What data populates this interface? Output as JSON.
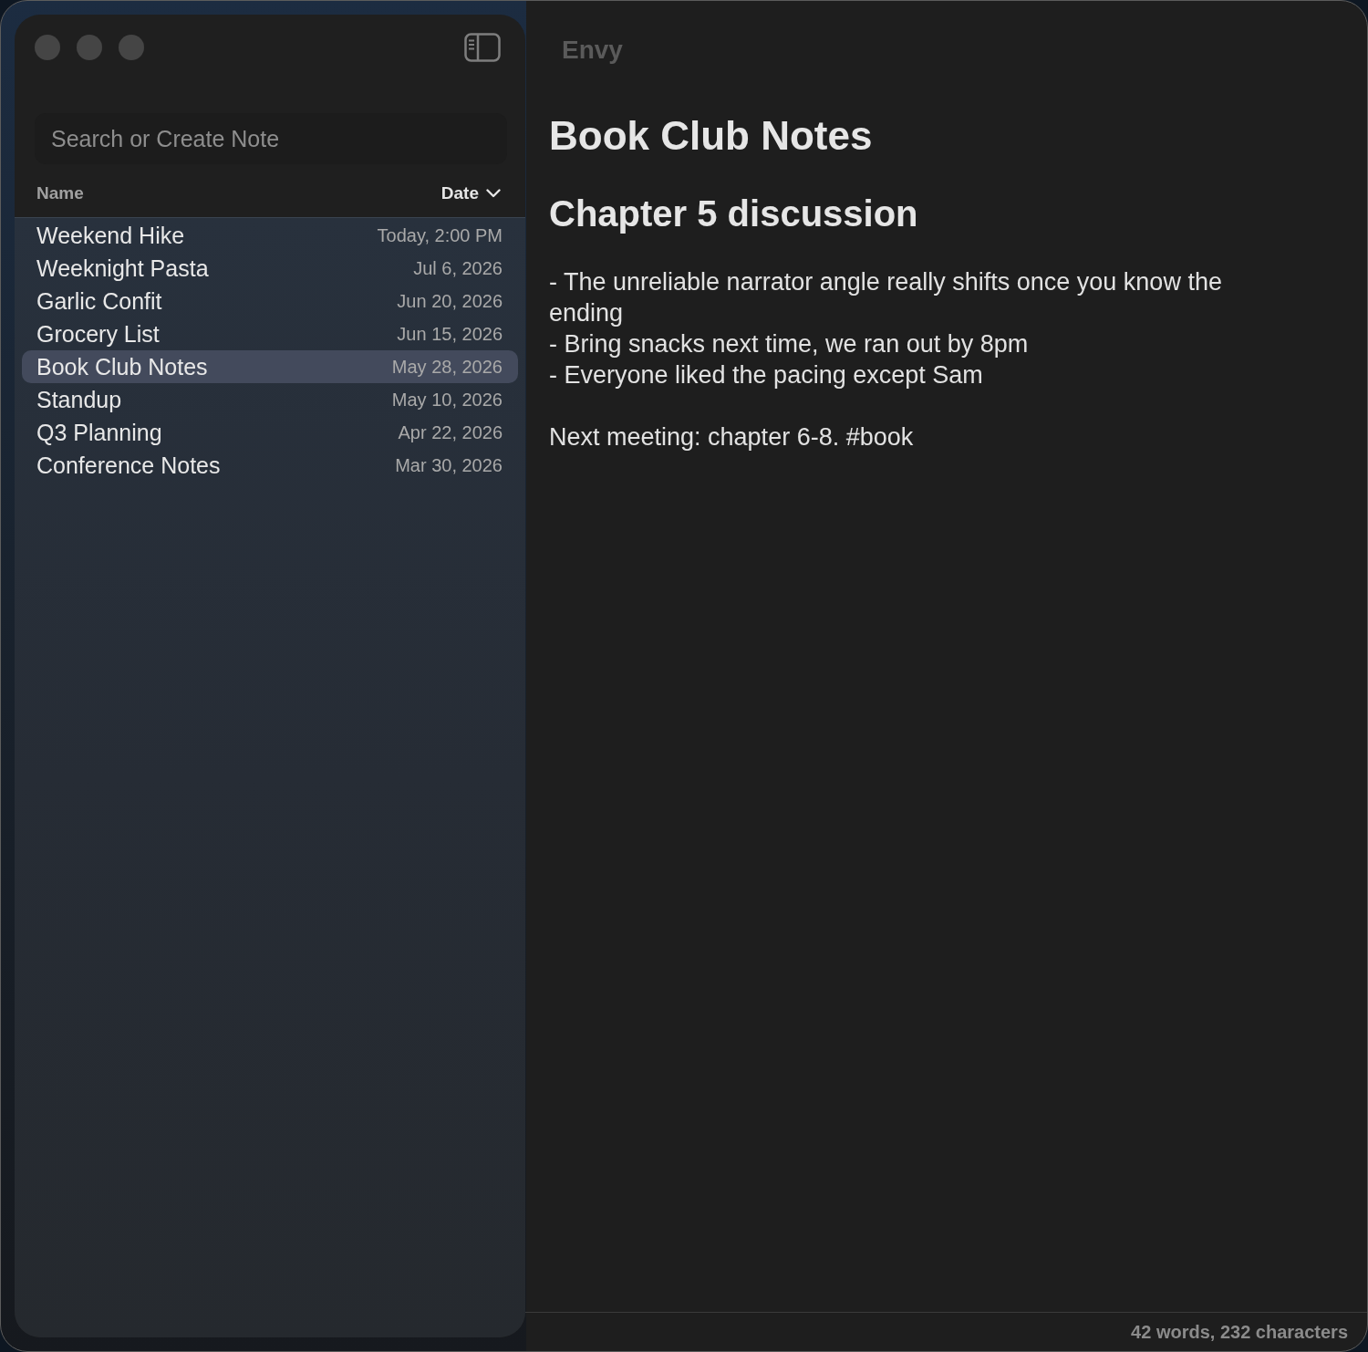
{
  "window": {
    "title": "Envy"
  },
  "sidebar": {
    "search": {
      "placeholder": "Search or Create Note"
    },
    "columns": [
      {
        "label": "Name",
        "sorted": false
      },
      {
        "label": "Date",
        "sorted": true
      }
    ],
    "notes": [
      {
        "name": "Weekend Hike",
        "date": "Today, 2:00 PM",
        "selected": false
      },
      {
        "name": "Weeknight Pasta",
        "date": "Jul 6, 2026",
        "selected": false
      },
      {
        "name": "Garlic Confit",
        "date": "Jun 20, 2026",
        "selected": false
      },
      {
        "name": "Grocery List",
        "date": "Jun 15, 2026",
        "selected": false
      },
      {
        "name": "Book Club Notes",
        "date": "May 28, 2026",
        "selected": true
      },
      {
        "name": "Standup",
        "date": "May 10, 2026",
        "selected": false
      },
      {
        "name": "Q3 Planning",
        "date": "Apr 22, 2026",
        "selected": false
      },
      {
        "name": "Conference Notes",
        "date": "Mar 30, 2026",
        "selected": false
      }
    ]
  },
  "editor": {
    "title": "Book Club Notes",
    "heading": "Chapter 5 discussion",
    "body": [
      {
        "kind": "bullet",
        "text": "- The unreliable narrator angle really shifts once you know the ending"
      },
      {
        "kind": "bullet",
        "text": "- Bring snacks next time, we ran out by 8pm"
      },
      {
        "kind": "bullet",
        "text": "- Everyone liked the pacing except Sam"
      },
      {
        "kind": "paragraph",
        "text": "Next meeting: chapter 6-8. #book"
      }
    ]
  },
  "status_bar": {
    "text": "42 words, 232 characters"
  }
}
